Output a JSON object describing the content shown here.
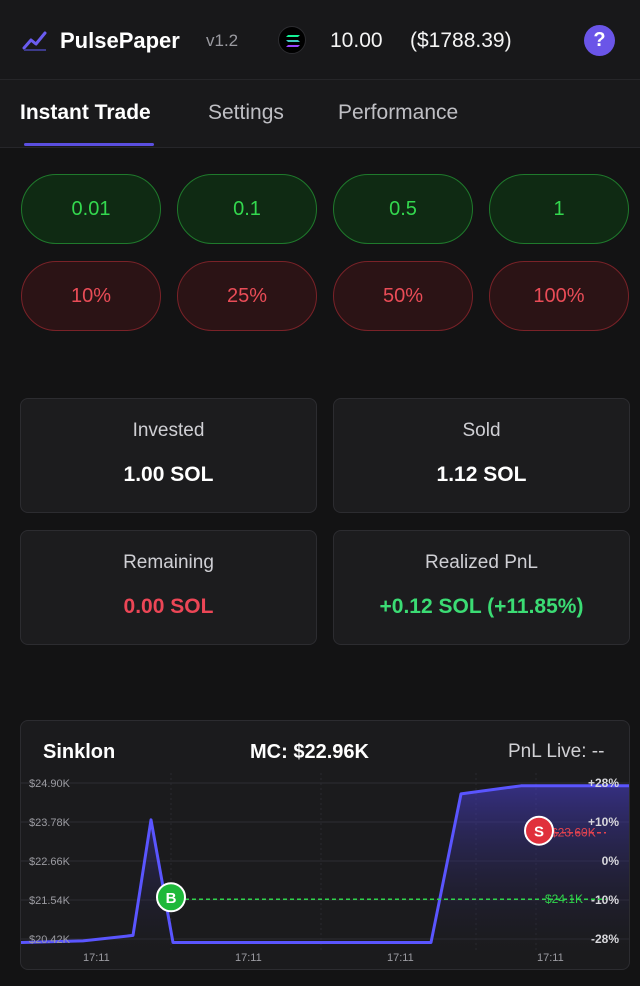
{
  "header": {
    "app_name": "PulsePaper",
    "version": "v1.2",
    "balance_sol": "10.00",
    "balance_usd": "($1788.39)",
    "help_label": "?",
    "icons": {
      "logo": "line-chart-icon",
      "sol": "solana-icon",
      "help": "question-icon"
    }
  },
  "tabs": [
    {
      "label": "Instant Trade",
      "active": true
    },
    {
      "label": "Settings",
      "active": false
    },
    {
      "label": "Performance",
      "active": false
    }
  ],
  "buy_amounts": [
    "0.01",
    "0.1",
    "0.5",
    "1"
  ],
  "sell_percents": [
    "10%",
    "25%",
    "50%",
    "100%"
  ],
  "stats": {
    "invested": {
      "label": "Invested",
      "value": "1.00 SOL"
    },
    "sold": {
      "label": "Sold",
      "value": "1.12 SOL"
    },
    "remaining": {
      "label": "Remaining",
      "value": "0.00 SOL"
    },
    "realized_pnl": {
      "label": "Realized PnL",
      "value": "+0.12 SOL (+11.85%)"
    }
  },
  "colors": {
    "accent": "#5b4fe0",
    "buy_green": "#33d84e",
    "sell_red": "#e94c57",
    "pnl_green": "#3bdc74",
    "line": "#5a55ff"
  },
  "chart": {
    "token": "Sinklon",
    "mc_label": "MC: $22.96K",
    "pnl_live": "PnL Live: --",
    "buy_marker": "B",
    "sell_marker": "S",
    "buy_price_label": "$24.1K",
    "sell_price_label": "$23.60K"
  },
  "chart_data": {
    "type": "area",
    "y_ticks": [
      "$24.90K",
      "$23.78K",
      "$22.66K",
      "$21.54K",
      "$20.42K"
    ],
    "right_ticks": [
      "+28%",
      "+10%",
      "0%",
      "-10%",
      "-28%"
    ],
    "x_ticks": [
      "17:11",
      "17:11",
      "17:11",
      "17:11"
    ],
    "ylim": [
      20.0,
      25.2
    ],
    "series": [
      {
        "values": [
          20.2,
          20.25,
          20.42,
          24.0,
          20.2,
          20.2,
          20.2,
          20.2,
          20.2,
          24.8,
          25.05,
          25.05
        ]
      }
    ],
    "buy_price": 21.54,
    "sell_price": 23.6
  }
}
